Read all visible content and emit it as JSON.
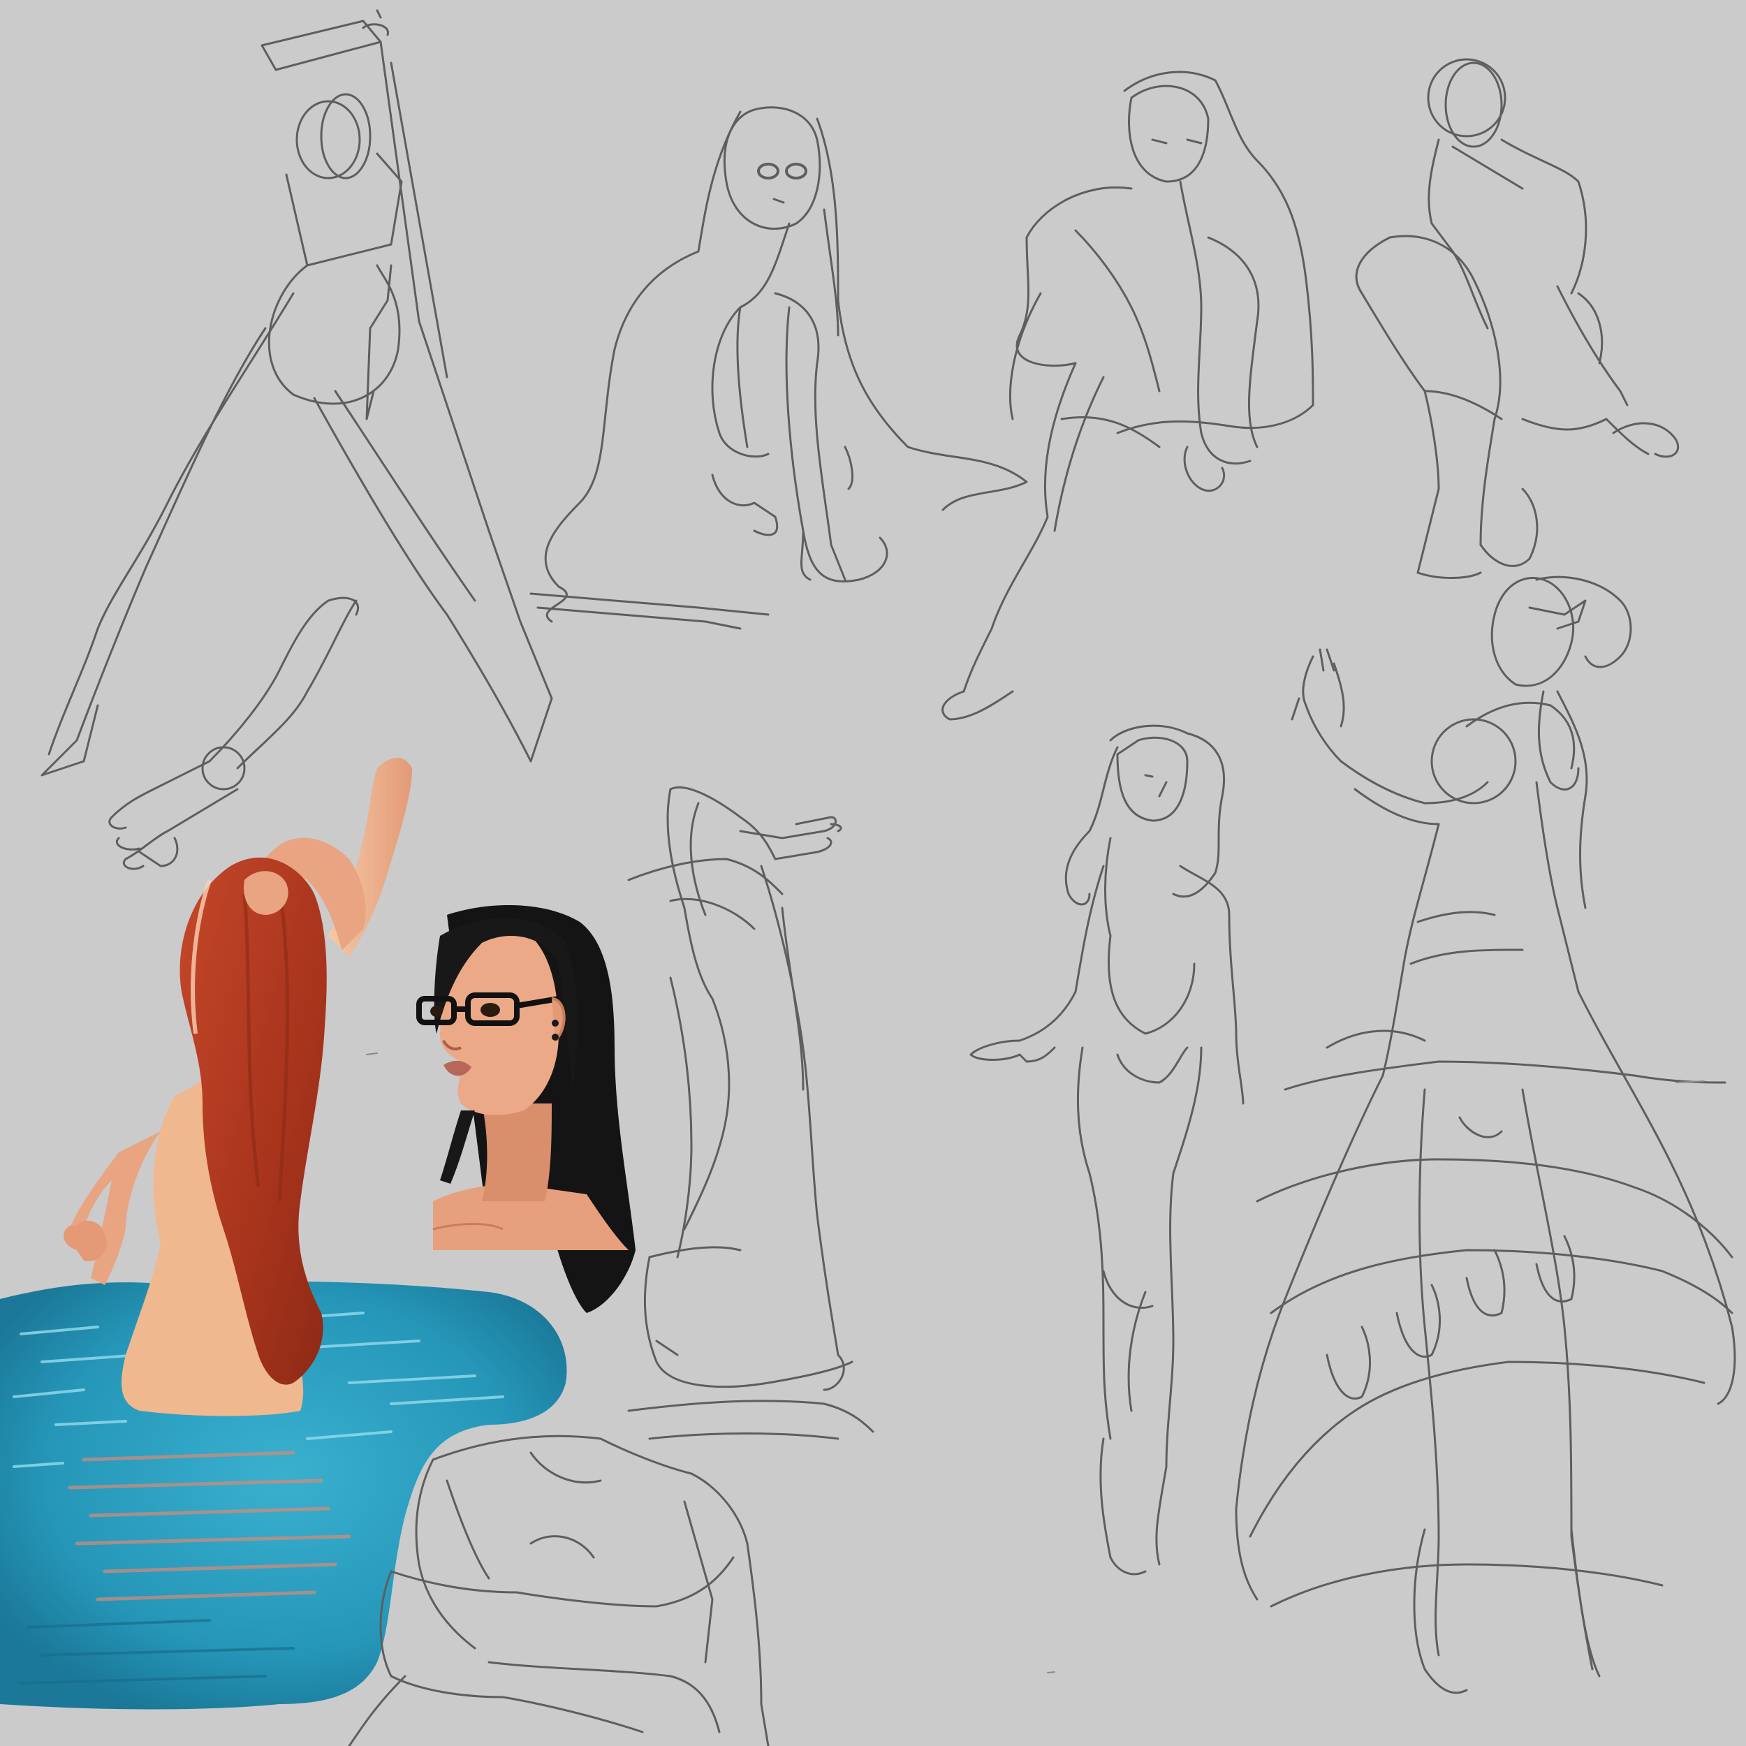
{
  "canvas": {
    "background": "#cbcbcb",
    "sketch_line_color": "#5e5e5e",
    "sketch_line_light": "#8a8a8a"
  },
  "palette": {
    "water_deep": "#1f7fa0",
    "water_light": "#3ab0cf",
    "water_highlight": "#8fd8ea",
    "hair_red": "#b0391f",
    "hair_red_dark": "#8c2a16",
    "skin": "#e7a07e",
    "skin_light": "#f4c9a6",
    "skin_shadow": "#c97c5c",
    "hair_black": "#121212",
    "lips": "#b8655a"
  },
  "artworks": [
    {
      "name": "lunge-pose-gesture-sketch",
      "style": "pencil"
    },
    {
      "name": "seated-long-haired-girl-sketch",
      "style": "pencil"
    },
    {
      "name": "reclining-girl-with-glasses-sketch",
      "style": "pencil"
    },
    {
      "name": "crouching-figure-sketch",
      "style": "pencil"
    },
    {
      "name": "arm-and-hand-study-sketch",
      "style": "pencil"
    },
    {
      "name": "red-haired-woman-in-water",
      "style": "colored"
    },
    {
      "name": "black-haired-woman-with-glasses-portrait",
      "style": "colored"
    },
    {
      "name": "reaching-figure-in-water-sketch",
      "style": "pencil"
    },
    {
      "name": "torso-study-sketch",
      "style": "pencil"
    },
    {
      "name": "standing-curly-haired-woman-sketch",
      "style": "pencil"
    },
    {
      "name": "dancing-woman-in-flowing-dress-sketch",
      "style": "pencil"
    }
  ]
}
